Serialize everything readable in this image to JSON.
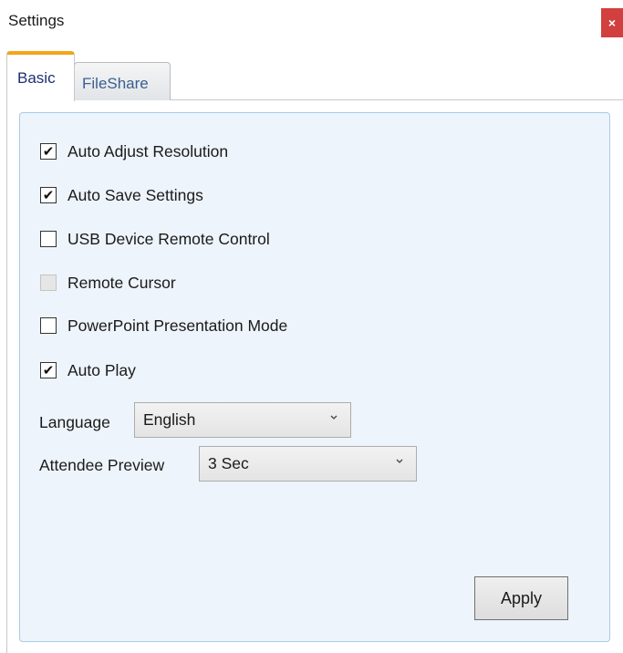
{
  "window": {
    "title": "Settings",
    "close_glyph": "×"
  },
  "tabs": [
    {
      "label": "Basic",
      "active": true
    },
    {
      "label": "FileShare",
      "active": false
    }
  ],
  "options": [
    {
      "label": "Auto Adjust Resolution",
      "checked": true,
      "enabled": true
    },
    {
      "label": "Auto Save Settings",
      "checked": true,
      "enabled": true
    },
    {
      "label": "USB Device Remote Control",
      "checked": false,
      "enabled": true
    },
    {
      "label": "Remote Cursor",
      "checked": false,
      "enabled": false
    },
    {
      "label": "PowerPoint Presentation Mode",
      "checked": false,
      "enabled": true
    },
    {
      "label": "Auto Play",
      "checked": true,
      "enabled": true
    }
  ],
  "check_glyph": "✔",
  "language": {
    "label": "Language",
    "value": "English"
  },
  "attendee_preview": {
    "label": "Attendee Preview",
    "value": "3 Sec"
  },
  "apply_button": "Apply",
  "colors": {
    "active_tab_accent": "#f2a51a",
    "close_button": "#d23f3f",
    "panel_background": "#edf4fb",
    "panel_border": "#a9cbe6"
  },
  "icons": {
    "close": "close-icon",
    "dropdown": "chevron-down-icon",
    "check": "checkmark-icon"
  }
}
